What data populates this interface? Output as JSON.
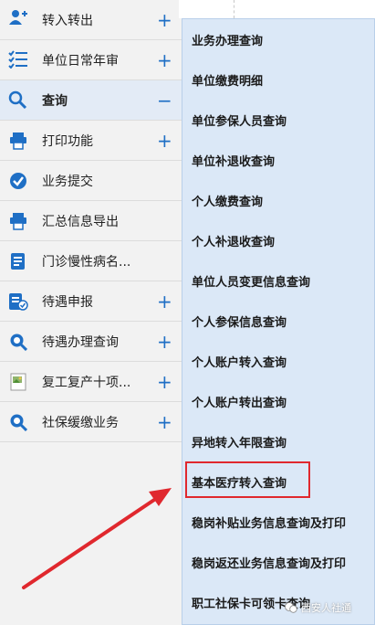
{
  "sidebar": {
    "items": [
      {
        "label": "转入转出",
        "icon": "user-add-icon",
        "toggle": "+"
      },
      {
        "label": "单位日常年审",
        "icon": "checklist-icon",
        "toggle": "+"
      },
      {
        "label": "查询",
        "icon": "search-icon",
        "toggle": "−",
        "active": true
      },
      {
        "label": "打印功能",
        "icon": "print-icon",
        "toggle": "+"
      },
      {
        "label": "业务提交",
        "icon": "check-circle-icon",
        "toggle": ""
      },
      {
        "label": "汇总信息导出",
        "icon": "print-export-icon",
        "toggle": ""
      },
      {
        "label": "门诊慢性病名...",
        "icon": "document-icon",
        "toggle": ""
      },
      {
        "label": "待遇申报",
        "icon": "form-check-icon",
        "toggle": "+"
      },
      {
        "label": "待遇办理查询",
        "icon": "search-badge-icon",
        "toggle": "+"
      },
      {
        "label": "复工复产十项...",
        "icon": "broken-image-icon",
        "toggle": "+"
      },
      {
        "label": "社保缓缴业务",
        "icon": "search-badge-icon",
        "toggle": "+"
      }
    ]
  },
  "dropdown": {
    "items": [
      "业务办理查询",
      "单位缴费明细",
      "单位参保人员查询",
      "单位补退收查询",
      "个人缴费查询",
      "个人补退收查询",
      "单位人员变更信息查询",
      "个人参保信息查询",
      "个人账户转入查询",
      "个人账户转出查询",
      "异地转入年限查询",
      "基本医疗转入查询",
      "稳岗补贴业务信息查询及打印",
      "稳岗返还业务信息查询及打印",
      "职工社保卡可领卡查询"
    ],
    "highlighted_index": 11
  },
  "watermark": {
    "text": "西安人社通"
  },
  "colors": {
    "accent": "#1f6fc5",
    "highlight": "#e0282e",
    "panel": "#dbe8f7",
    "sidebar": "#f2f2f2"
  }
}
